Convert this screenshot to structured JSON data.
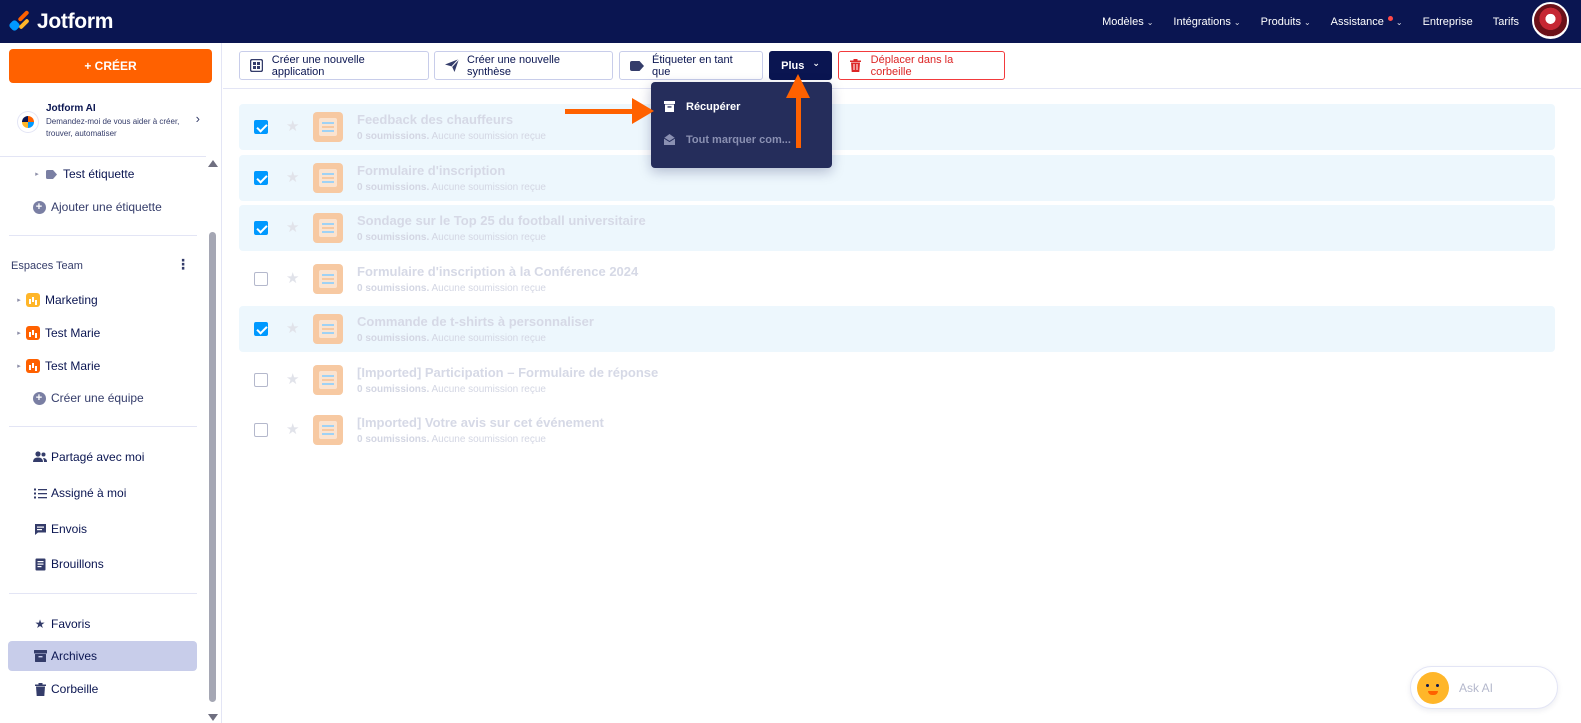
{
  "brand": {
    "name": "Jotform",
    "colors": {
      "navy": "#0a1551",
      "orange": "#ff6100",
      "blue": "#0099ff",
      "yellow": "#ffb629",
      "danger": "#dc2626"
    }
  },
  "topnav": {
    "items": [
      {
        "label": "Modèles",
        "dropdown": true
      },
      {
        "label": "Intégrations",
        "dropdown": true
      },
      {
        "label": "Produits",
        "dropdown": true
      },
      {
        "label": "Assistance",
        "dropdown": true,
        "notification_dot": true
      },
      {
        "label": "Entreprise",
        "dropdown": false
      },
      {
        "label": "Tarifs",
        "dropdown": false
      }
    ]
  },
  "sidebar": {
    "create_label": "+ CRÉER",
    "ai": {
      "title": "Jotform AI",
      "description": "Demandez-moi de vous aider à créer, trouver, automatiser"
    },
    "label_item": "Test étiquette",
    "add_label": "Ajouter une étiquette",
    "teams_header": "Espaces Team",
    "teams": [
      {
        "label": "Marketing",
        "icon": "yellow"
      },
      {
        "label": "Test Marie",
        "icon": "orange"
      },
      {
        "label": "Test Marie",
        "icon": "orange"
      }
    ],
    "create_team": "Créer une équipe",
    "nav_group_1": [
      {
        "label": "Partagé avec moi",
        "icon": "users-icon"
      },
      {
        "label": "Assigné à moi",
        "icon": "checklist-icon"
      },
      {
        "label": "Envois",
        "icon": "message-icon"
      },
      {
        "label": "Brouillons",
        "icon": "draft-icon"
      }
    ],
    "nav_group_2": [
      {
        "label": "Favoris",
        "icon": "star-icon",
        "active": false
      },
      {
        "label": "Archives",
        "icon": "archive-icon",
        "active": true
      },
      {
        "label": "Corbeille",
        "icon": "trash-icon",
        "active": false
      }
    ]
  },
  "toolbar": {
    "create_app": "Créer une nouvelle application",
    "create_report": "Créer une nouvelle synthèse",
    "label_as": "Étiqueter en tant que",
    "more": "Plus",
    "move_to_trash": "Déplacer dans la corbeille"
  },
  "dropdown": {
    "items": [
      {
        "label": "Récupérer",
        "icon": "archive-restore-icon",
        "enabled": true
      },
      {
        "label": "Tout marquer com...",
        "icon": "mail-open-icon",
        "enabled": false
      }
    ]
  },
  "forms": [
    {
      "title": "Feedback des chauffeurs",
      "count": "0 soumissions.",
      "status": "Aucune soumission reçue",
      "selected": true
    },
    {
      "title": "Formulaire d'inscription",
      "count": "0 soumissions.",
      "status": "Aucune soumission reçue",
      "selected": true
    },
    {
      "title": "Sondage sur le Top 25 du football universitaire",
      "count": "0 soumissions.",
      "status": "Aucune soumission reçue",
      "selected": true
    },
    {
      "title": "Formulaire d'inscription à la Conférence 2024",
      "count": "0 soumissions.",
      "status": "Aucune soumission reçue",
      "selected": false
    },
    {
      "title": "Commande de t-shirts à personnaliser",
      "count": "0 soumissions.",
      "status": "Aucune soumission reçue",
      "selected": true
    },
    {
      "title": "[Imported] Participation – Formulaire de réponse",
      "count": "0 soumissions.",
      "status": "Aucune soumission reçue",
      "selected": false
    },
    {
      "title": "[Imported] Votre avis sur cet événement",
      "count": "0 soumissions.",
      "status": "Aucune soumission reçue",
      "selected": false
    }
  ],
  "ask_ai": {
    "label": "Ask AI"
  }
}
